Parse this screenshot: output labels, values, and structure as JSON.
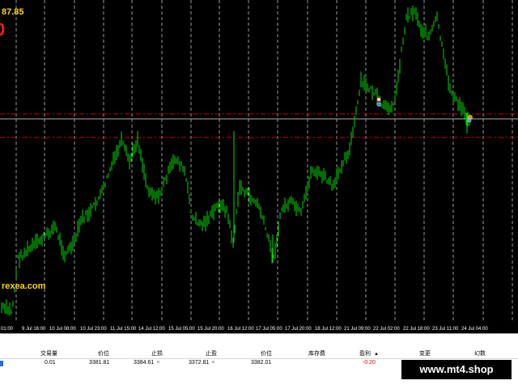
{
  "chart": {
    "price_readout": "87.85",
    "profit_glyph": "0",
    "brand_fragment": "rexea.com",
    "time_labels": [
      "01:00",
      "9 Jul 16:00",
      "10 Jul 08:00",
      "10 Jul 23:00",
      "11 Jul 15:00",
      "14 Jul 12:00",
      "15 Jul 05:00",
      "15 Jul 20:00",
      "16 Jul 12:00",
      "17 Jul 05:00",
      "17 Jul 20:00",
      "18 Jul 12:00",
      "21 Jul 09:00",
      "22 Jul 02:00",
      "22 Jul 18:00",
      "23 Jul 11:00",
      "24 Jul 04:00"
    ],
    "colors": {
      "background": "#000000",
      "candle": "#00dd00",
      "grid": "#9a9a9a",
      "level_line": "#cc0000",
      "price_line": "#b0b0b0",
      "text_accent": "#ffd500"
    }
  },
  "terminal": {
    "columns": [
      {
        "key": "volume",
        "label": "交易量"
      },
      {
        "key": "open_price",
        "label": "价位"
      },
      {
        "key": "sl",
        "label": "止损"
      },
      {
        "key": "tp",
        "label": "止盈"
      },
      {
        "key": "current_price",
        "label": "价位"
      },
      {
        "key": "swap",
        "label": "库存费"
      },
      {
        "key": "profit",
        "label": "盈利"
      },
      {
        "key": "change",
        "label": "变更"
      },
      {
        "key": "pips",
        "label": "幻数"
      }
    ],
    "order": {
      "volume": "0.01",
      "open_price": "3381.81",
      "sl": "3384.61",
      "tp": "3372.81",
      "current_price": "3382.01",
      "profit": "-0.20"
    },
    "delete_mark": "×",
    "sort_arrow": "▲"
  },
  "watermark": "www.mt4.shop"
}
